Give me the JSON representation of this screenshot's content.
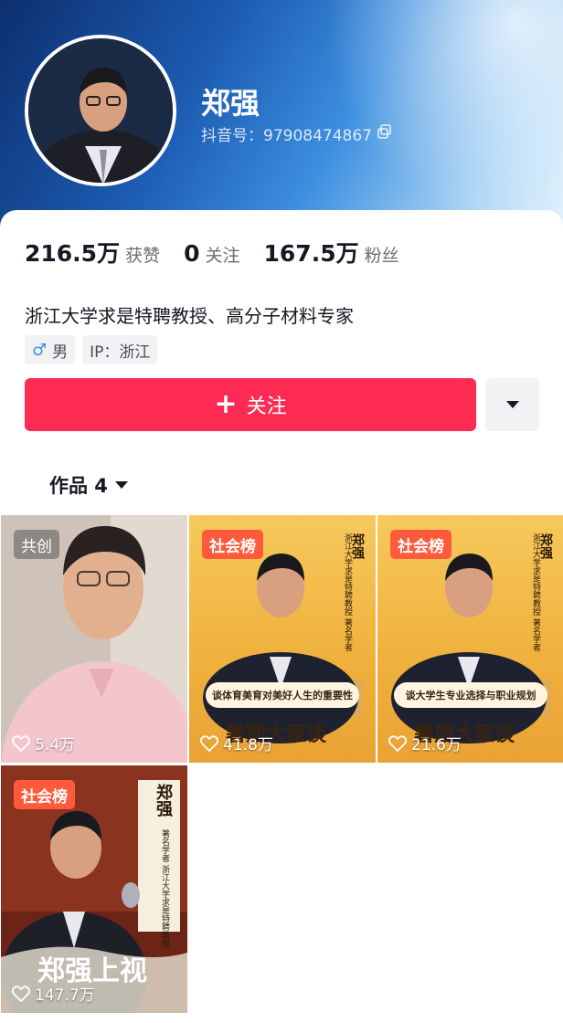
{
  "profile": {
    "name": "郑强",
    "douyin_id": "抖音号：97908474867",
    "bio": "浙江大学求是特聘教授、高分子材料专家",
    "tags": [
      "男",
      "IP：浙江"
    ]
  },
  "stats": [
    {
      "value": "216.5万",
      "label": "获赞"
    },
    {
      "value": "0",
      "label": "关注"
    },
    {
      "value": "167.5万",
      "label": "粉丝"
    }
  ],
  "actions": {
    "follow_label": "关注"
  },
  "tabs": {
    "works_label": "作品 4"
  },
  "videos": [
    {
      "badge": "共创",
      "likes": "5.4万"
    },
    {
      "badge": "社会榜",
      "likes": "41.8万",
      "caption": "谈体育美育对美好人生的重要性",
      "poster_name": "郑强",
      "poster_title": "浙江大学求是特聘教授 著名学者",
      "brand": "暑期大家谈"
    },
    {
      "badge": "社会榜",
      "likes": "21.6万",
      "caption": "谈大学生专业选择与职业规划",
      "poster_name": "郑强",
      "poster_title": "浙江大学求是特聘教授 著名学者",
      "brand": "暑期大家谈"
    },
    {
      "badge": "社会榜",
      "likes": "147.7万",
      "poster_name": "郑强",
      "poster_title": "著名学者 浙江大学求是特聘教授",
      "brand": "郑强上视"
    }
  ],
  "colors": {
    "accent": "#fe2c55",
    "badge_orange": "#ff5a3c"
  }
}
